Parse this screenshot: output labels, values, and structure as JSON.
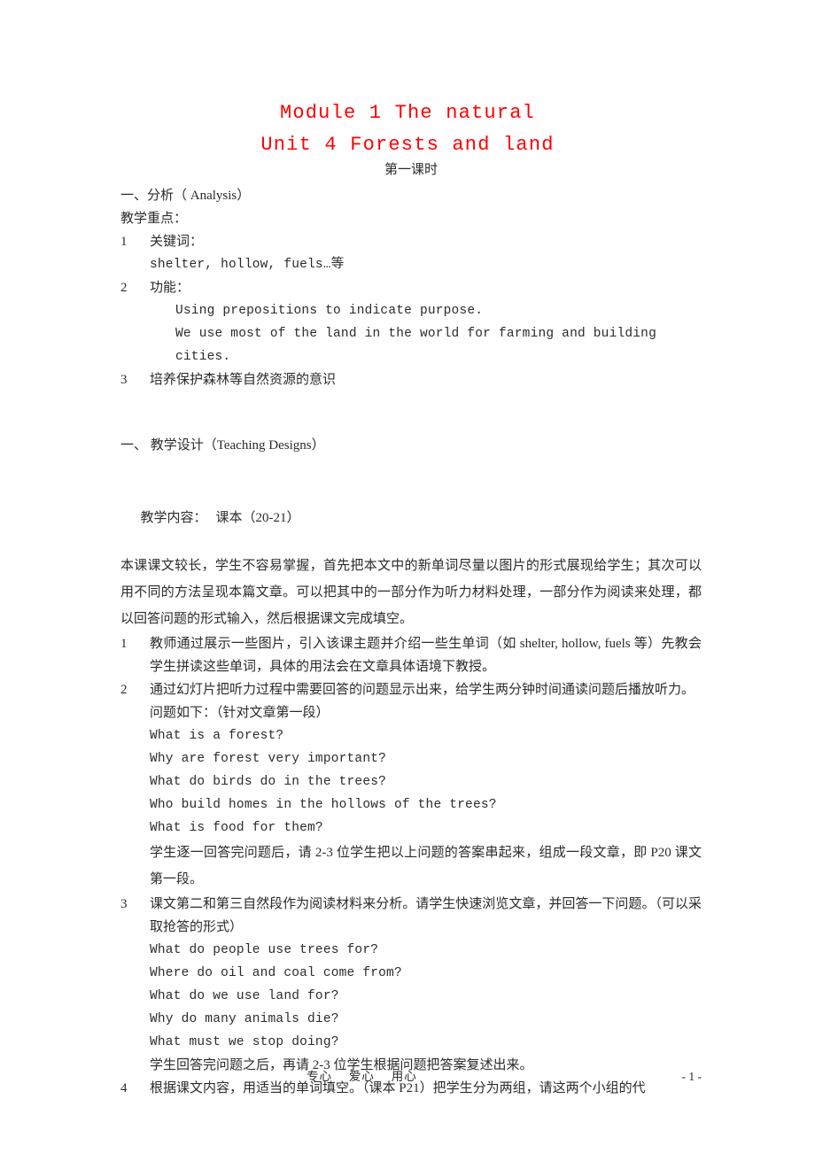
{
  "document": {
    "title_line_1": "Module 1 The natural",
    "title_line_2": "Unit 4 Forests and land",
    "subtitle": "第一课时",
    "title_color": "#ff0000"
  },
  "analysis": {
    "heading": "一、分析（ Analysis）",
    "focus_label": "教学重点：",
    "item1_num": "1",
    "item1_label": "关键词：",
    "item1_words": "shelter, hollow, fuels…等",
    "item2_num": "2",
    "item2_label": "功能：",
    "item2_sentence_1": "Using prepositions to indicate purpose.",
    "item2_sentence_2": "We use most of the land in the world for farming and building cities.",
    "item3_num": "3",
    "item3_text": "培养保护森林等自然资源的意识"
  },
  "teaching_design": {
    "heading": "一、 教学设计（Teaching Designs）",
    "content_label": "教学内容：",
    "content_value": "课本（20-21）",
    "intro_paragraph": "本课课文较长，学生不容易掌握，首先把本文中的新单词尽量以图片的形式展现给学生；其次可以用不同的方法呈现本篇文章。可以把其中的一部分作为听力材料处理，一部分作为阅读来处理，都以回答问题的形式输入，然后根据课文完成填空。",
    "steps": [
      {
        "num": "1",
        "text": "教师通过展示一些图片，引入该课主题并介绍一些生单词（如 shelter, hollow, fuels 等）先教会学生拼读这些单词，具体的用法会在文章具体语境下教授。"
      },
      {
        "num": "2",
        "text": "通过幻灯片把听力过程中需要回答的问题显示出来，给学生两分钟时间通读问题后播放听力。"
      },
      {
        "num": "3",
        "text": "课文第二和第三自然段作为阅读材料来分析。请学生快速浏览文章，并回答一下问题。（可以采取抢答的形式）"
      },
      {
        "num": "4",
        "text": "根据课文内容，用适当的单词填空。（课本 P21）把学生分为两组，请这两个小组的代"
      }
    ],
    "questions_intro_1": "问题如下：（针对文章第一段）",
    "questions_group_1": [
      "What is a forest?",
      "Why are forest very important?",
      "What do birds do in the trees?",
      "Who build homes in the hollows of the trees?",
      "What is food for them?"
    ],
    "after_group_1_note": "学生逐一回答完问题后，请 2-3 位学生把以上问题的答案串起来，组成一段文章，即 P20 课文第一段。",
    "questions_group_2": [
      "What do people use trees for?",
      "Where do oil and coal come from?",
      "What do we use land for?",
      "Why do many animals die?",
      "What must we stop doing?"
    ],
    "after_group_2_note": "学生回答完问题之后，再请 2-3 位学生根据问题把答案复述出来。"
  },
  "footer": {
    "slogan": "专心　 爱心　 用心",
    "page_number": "- 1 -"
  }
}
